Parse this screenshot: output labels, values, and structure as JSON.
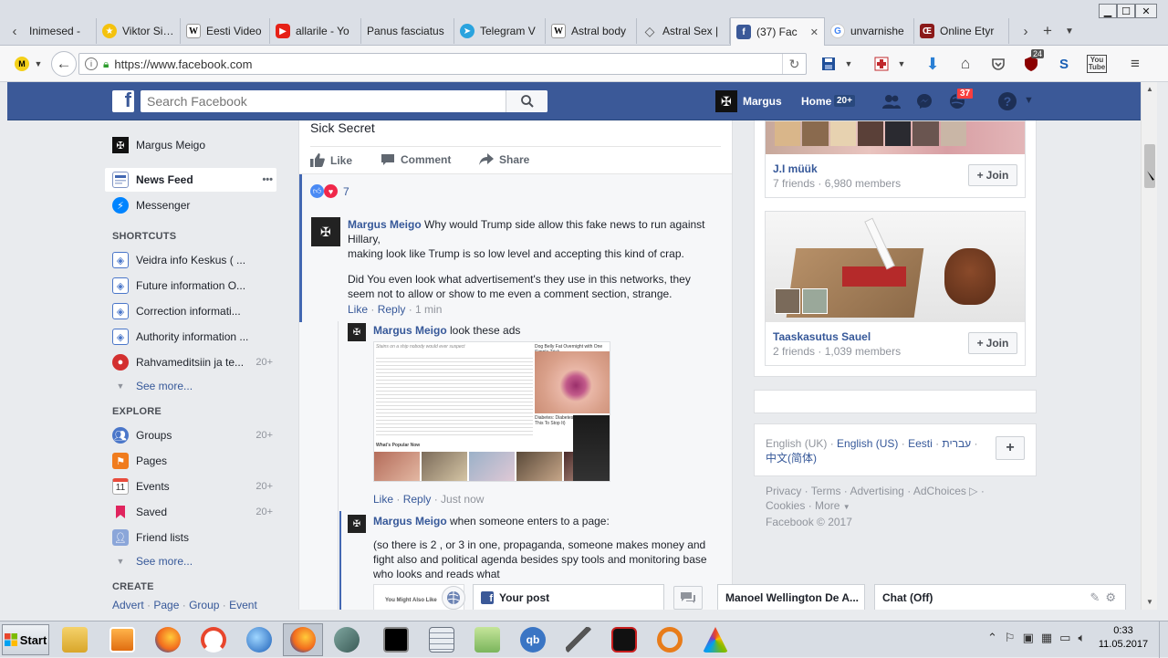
{
  "browser": {
    "tabs": [
      {
        "label": "Inimesed -",
        "icon": "generic-page-icon",
        "color": "#6d6d6d"
      },
      {
        "label": "Viktor Siilat",
        "icon": "star-badge-icon",
        "color": "#f4c20d"
      },
      {
        "label": "Eesti Video",
        "icon": "wikipedia-icon",
        "color": "#333333"
      },
      {
        "label": "allarile - Yo",
        "icon": "youtube-icon",
        "color": "#e62117"
      },
      {
        "label": "Panus fasciatus",
        "icon": "",
        "color": ""
      },
      {
        "label": "Telegram V",
        "icon": "telegram-icon",
        "color": "#2aa3de"
      },
      {
        "label": "Astral body",
        "icon": "wikipedia-icon",
        "color": "#333333"
      },
      {
        "label": "Astral Sex |",
        "icon": "diamond-icon",
        "color": "#555555"
      },
      {
        "label": "(37) Fac",
        "icon": "facebook-icon",
        "color": "#3b5998",
        "active": true
      },
      {
        "label": "unvarnishe",
        "icon": "google-icon",
        "color": "#4285f4"
      },
      {
        "label": "Online Etyr",
        "icon": "etymonline-icon",
        "color": "#8b1a1a"
      }
    ],
    "window": {
      "minimize": "▁",
      "maximize": "☐",
      "close": "✕"
    },
    "url": "https://www.facebook.com",
    "addon_badge": "24"
  },
  "fb": {
    "search_placeholder": "Search Facebook",
    "user_name": "Margus",
    "home_label": "Home",
    "home_count": "20+",
    "notif_count": "37"
  },
  "leftnav": {
    "profile": "Margus Meigo",
    "news_feed": "News Feed",
    "news_feed_more": "•••",
    "messenger": "Messenger",
    "shortcuts_head": "SHORTCUTS",
    "shortcuts": [
      {
        "label": "Veidra info Keskus ( ...",
        "count": ""
      },
      {
        "label": "Future information O...",
        "count": ""
      },
      {
        "label": "Correction informati...",
        "count": ""
      },
      {
        "label": "Authority information ...",
        "count": ""
      },
      {
        "label": "Rahvameditsiin ja te...",
        "count": "20+"
      }
    ],
    "see_more": "See more...",
    "explore_head": "EXPLORE",
    "explore": [
      {
        "label": "Groups",
        "count": "20+",
        "icon": "groups-icon"
      },
      {
        "label": "Pages",
        "count": "",
        "icon": "pages-flag-icon"
      },
      {
        "label": "Events",
        "count": "20+",
        "icon": "calendar-icon"
      },
      {
        "label": "Saved",
        "count": "20+",
        "icon": "bookmark-icon"
      },
      {
        "label": "Friend lists",
        "count": "",
        "icon": "friend-list-icon"
      }
    ],
    "create_head": "CREATE",
    "create_links": [
      "Advert",
      "Page",
      "Group",
      "Event"
    ]
  },
  "feed": {
    "post_title": "Sick Secret",
    "actions": {
      "like": "Like",
      "comment": "Comment",
      "share": "Share"
    },
    "reactions_count": "7",
    "comments": [
      {
        "author": "Margus Meigo",
        "text1": "Why would Trump side allow this fake news to run against Hillary,",
        "text2": "making look like Trump is so low level and accepting this kind of crap.",
        "text3": "Did You even look what advertisement's they use in this networks, they seem not to allow or show to me even a comment section, strange.",
        "like": "Like",
        "reply": "Reply",
        "time": "1 min"
      },
      {
        "author": "Margus Meigo",
        "text1": "look these ads",
        "like": "Like",
        "reply": "Reply",
        "time": "Just now"
      },
      {
        "author": "Margus Meigo",
        "text1": "when someone enters to a page:",
        "text2": "(so there is 2 , or 3 in one, propaganda, someone makes money and fight also and political agenda besides spy tools and monitoring base who looks and reads what"
      }
    ],
    "ad_caption_1": "Stains on a ship nobody would ever suspect",
    "ad_caption_2": "Dog Belly Fat Overnight with One Simple Trick",
    "ad_caption_3": "Diabetes: Diabetes Will Kill You (Do This To Stop It)",
    "ad_caption_4": "What's Popular Now",
    "ad2_caption": "You Might Also Like"
  },
  "right": {
    "groups": [
      {
        "name": "J.I müük",
        "meta": "7 friends · 6,980 members",
        "join": "Join"
      },
      {
        "name": "Taaskasutus Sauel",
        "meta": "2 friends · 1,039 members",
        "join": "Join"
      }
    ],
    "languages": [
      "English (UK)",
      "English (US)",
      "Eesti",
      "עברית",
      "中文(简体)"
    ],
    "footer_links": [
      "Privacy",
      "Terms",
      "Advertising",
      "AdChoices",
      "Cookies",
      "More"
    ],
    "copyright": "Facebook © 2017"
  },
  "dock": {
    "your_post": "Your post",
    "chat_tab": "Manoel Wellington De A...",
    "chat_off": "Chat (Off)"
  },
  "taskbar": {
    "start": "Start",
    "time": "0:33",
    "date": "11.05.2017"
  }
}
